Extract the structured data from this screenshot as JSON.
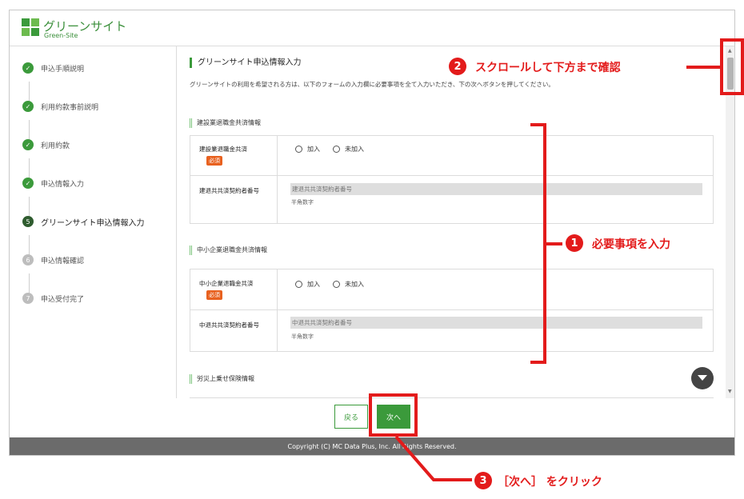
{
  "header": {
    "logo_text": "グリーンサイト",
    "logo_sub": "Green-Site"
  },
  "sidebar": {
    "steps": [
      {
        "num": "✓",
        "label": "申込手順説明",
        "state": "done"
      },
      {
        "num": "✓",
        "label": "利用約款事前説明",
        "state": "done"
      },
      {
        "num": "✓",
        "label": "利用約款",
        "state": "done"
      },
      {
        "num": "✓",
        "label": "申込情報入力",
        "state": "done"
      },
      {
        "num": "5",
        "label": "グリーンサイト申込情報入力",
        "state": "active"
      },
      {
        "num": "6",
        "label": "申込情報確認",
        "state": "todo"
      },
      {
        "num": "7",
        "label": "申込受付完了",
        "state": "todo"
      }
    ]
  },
  "main": {
    "title": "グリーンサイト申込情報入力",
    "description": "グリーンサイトの利用を希望される方は、以下のフォームの入力欄に必要事項を全て入力いただき、下の次へボタンを押してください。",
    "sections": [
      {
        "title": "建設業退職金共済情報",
        "radio_label": "建設業退職金共済",
        "required": "必須",
        "options": [
          "加入",
          "未加入"
        ],
        "input_label": "建退共共済契約者番号",
        "input_placeholder": "建退共共済契約者番号",
        "hint": "半角数字"
      },
      {
        "title": "中小企業退職金共済情報",
        "radio_label": "中小企業退職金共済",
        "required": "必須",
        "options": [
          "加入",
          "未加入"
        ],
        "input_label": "中退共共済契約者番号",
        "input_placeholder": "中退共共済契約者番号",
        "hint": "半角数字"
      },
      {
        "title": "労災上乗せ保険情報"
      }
    ]
  },
  "buttons": {
    "back": "戻る",
    "next": "次へ"
  },
  "footer": {
    "copyright": "Copyright (C) MC Data Plus, Inc. All Rights Reserved."
  },
  "annotations": {
    "a1": {
      "num": "1",
      "text": "必要事項を入力"
    },
    "a2": {
      "num": "2",
      "text": "スクロールして下方まで確認"
    },
    "a3": {
      "num": "3",
      "text": "［次へ］ をクリック"
    }
  },
  "colors": {
    "brand": "#3b9a3b",
    "annotation": "#e31b1b",
    "required": "#e8611f"
  }
}
